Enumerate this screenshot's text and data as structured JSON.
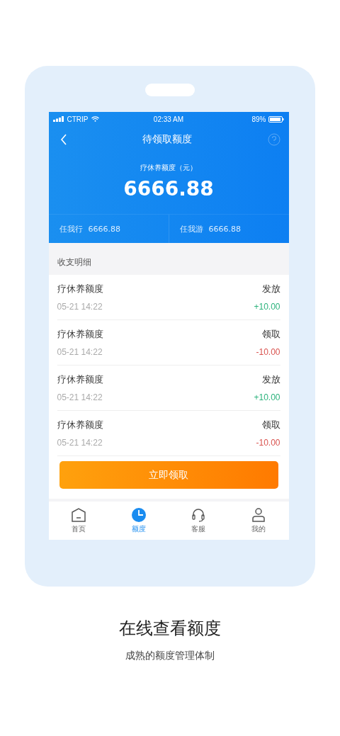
{
  "status_bar": {
    "carrier": "CTRIP",
    "time": "02:33 AM",
    "battery": "89%"
  },
  "header": {
    "title": "待领取额度",
    "balance_label": "疗休养额度（元）",
    "balance": "6666.88",
    "sub_balances": [
      {
        "label": "任我行",
        "value": "6666.88"
      },
      {
        "label": "任我游",
        "value": "6666.88"
      }
    ]
  },
  "section_title": "收支明细",
  "transactions": [
    {
      "name": "疗休养额度",
      "time": "05-21  14:22",
      "type": "发放",
      "amount": "+10.00",
      "kind": "credit"
    },
    {
      "name": "疗休养额度",
      "time": "05-21  14:22",
      "type": "领取",
      "amount": "-10.00",
      "kind": "debit"
    },
    {
      "name": "疗休养额度",
      "time": "05-21  14:22",
      "type": "发放",
      "amount": "+10.00",
      "kind": "credit"
    },
    {
      "name": "疗休养额度",
      "time": "05-21  14:22",
      "type": "领取",
      "amount": "-10.00",
      "kind": "debit"
    }
  ],
  "claim_button": "立即领取",
  "tabs": [
    {
      "label": "首页",
      "kind": "home",
      "selected": false
    },
    {
      "label": "额度",
      "kind": "pie",
      "selected": true
    },
    {
      "label": "客服",
      "kind": "headset",
      "selected": false
    },
    {
      "label": "我的",
      "kind": "user",
      "selected": false
    }
  ],
  "caption": {
    "title": "在线查看额度",
    "subtitle": "成熟的额度管理体制"
  }
}
